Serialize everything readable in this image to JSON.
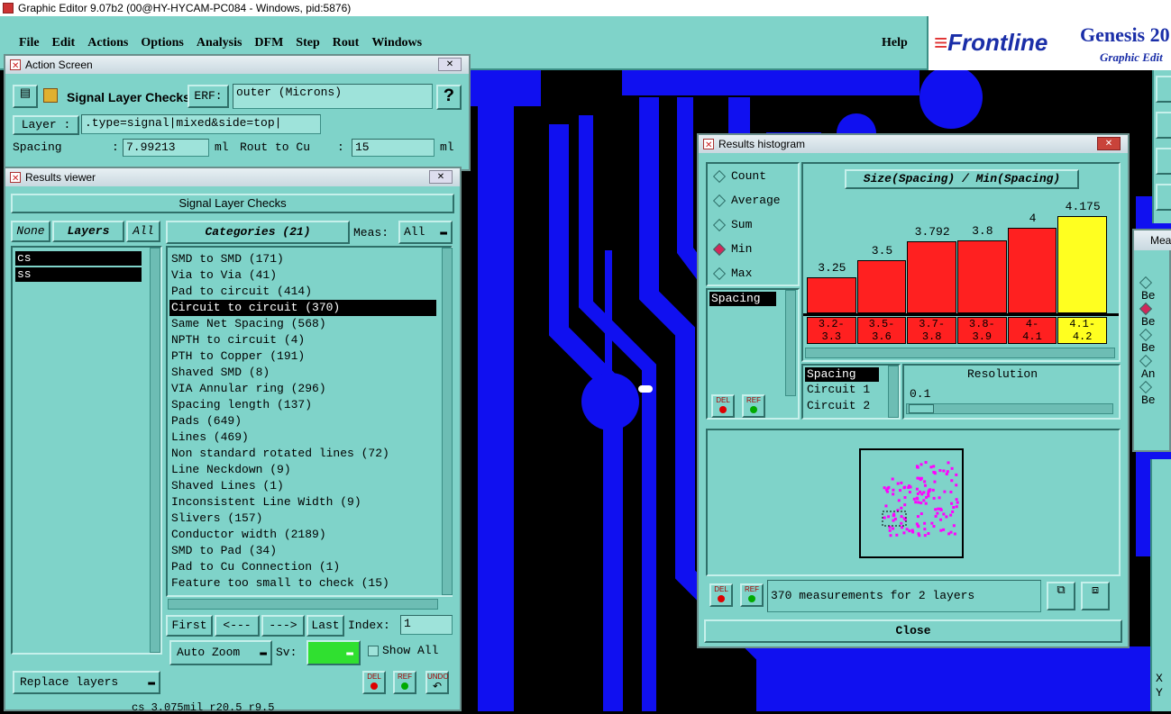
{
  "os": {
    "title": "Graphic Editor 9.07b2 (00@HY-HYCAM-PC084 - Windows, pid:5876)"
  },
  "menu": {
    "items": [
      "File",
      "Edit",
      "Actions",
      "Options",
      "Analysis",
      "DFM",
      "Step",
      "Rout",
      "Windows"
    ],
    "help": "Help",
    "brand_logo": "Frontline",
    "brand_title": "Genesis 20",
    "brand_sub": "Graphic Edit"
  },
  "action_screen": {
    "title": "Action Screen",
    "action_name": "Signal Layer Checks",
    "erf_label": "ERF:",
    "erf_value": "outer (Microns)",
    "help_btn": "?",
    "layer_label": "Layer :",
    "layer_value": ".type=signal|mixed&side=top|",
    "spacing_label": "Spacing",
    "spacing_value": "7.99213",
    "spacing_unit": "ml",
    "rout_label": "Rout to Cu",
    "rout_value": "15",
    "rout_unit": "ml"
  },
  "results_viewer": {
    "title": "Results viewer",
    "header": "Signal Layer Checks",
    "none_btn": "None",
    "layers_btn": "Layers",
    "all_btn": "All",
    "layers": [
      "cs",
      "ss"
    ],
    "categories_btn": "Categories (21)",
    "meas_label": "Meas:",
    "meas_value": "All",
    "categories": [
      "SMD to SMD (171)",
      "Via to Via (41)",
      "Pad to circuit (414)",
      "Circuit to circuit (370)",
      "Same Net Spacing (568)",
      "NPTH to circuit (4)",
      "PTH to Copper (191)",
      "Shaved SMD (8)",
      "VIA Annular ring (296)",
      "Spacing length (137)",
      "Pads (649)",
      "Lines (469)",
      "Non standard rotated lines (72)",
      "Line Neckdown (9)",
      "Shaved Lines (1)",
      "Inconsistent Line Width (9)",
      "Slivers (157)",
      "Conductor width (2189)",
      "SMD to Pad (34)",
      "Pad to Cu Connection (1)",
      "Feature too small to check (15)"
    ],
    "selected_index": 3,
    "first_btn": "First",
    "prev_btn": "<---",
    "next_btn": "--->",
    "last_btn": "Last",
    "index_label": "Index:",
    "index_value": "1",
    "auto_zoom": "Auto Zoom",
    "sv_label": "Sv:",
    "show_all": "Show All",
    "replace_layers": "Replace layers",
    "del": "DEL",
    "ref": "REF",
    "undo": "UNDO",
    "status": "cs 3.075mil r20.5 r9.5"
  },
  "histogram": {
    "title": "Results histogram",
    "modes": [
      "Count",
      "Average",
      "Sum",
      "Min",
      "Max"
    ],
    "selected_mode": "Min",
    "chart_title": "Size(Spacing) / Min(Spacing)",
    "param_list": [
      "Spacing"
    ],
    "param_list2": [
      "Spacing",
      "Circuit 1",
      "Circuit 2"
    ],
    "resolution_label": "Resolution",
    "resolution_value": "0.1",
    "summary": "370 measurements for 2 layers",
    "close": "Close",
    "del": "DEL",
    "ref": "REF",
    "colors": {
      "normal": "#ff2020",
      "highlight": "#ffff20"
    }
  },
  "chart_data": {
    "type": "bar",
    "title": "Size(Spacing) / Min(Spacing)",
    "categories": [
      "3.2-3.3",
      "3.5-3.6",
      "3.7-3.8",
      "3.8-3.9",
      "4-4.1",
      "4.1-4.2"
    ],
    "values": [
      3.25,
      3.5,
      3.792,
      3.8,
      4,
      4.175
    ],
    "value_labels": [
      "3.25",
      "3.5",
      "3.792",
      "3.8",
      "4",
      "4.175"
    ],
    "bin_labels": [
      [
        "3.2-",
        "3.3"
      ],
      [
        "3.5-",
        "3.6"
      ],
      [
        "3.7-",
        "3.8"
      ],
      [
        "3.8-",
        "3.9"
      ],
      [
        "4-",
        "4.1"
      ],
      [
        "4.1-",
        "4.2"
      ]
    ],
    "highlighted": [
      5
    ]
  },
  "measure_panel": {
    "title": "Mea",
    "items": [
      "Be",
      "Be",
      "Be",
      "An",
      "Be"
    ],
    "coords": [
      "X",
      "Y"
    ]
  }
}
